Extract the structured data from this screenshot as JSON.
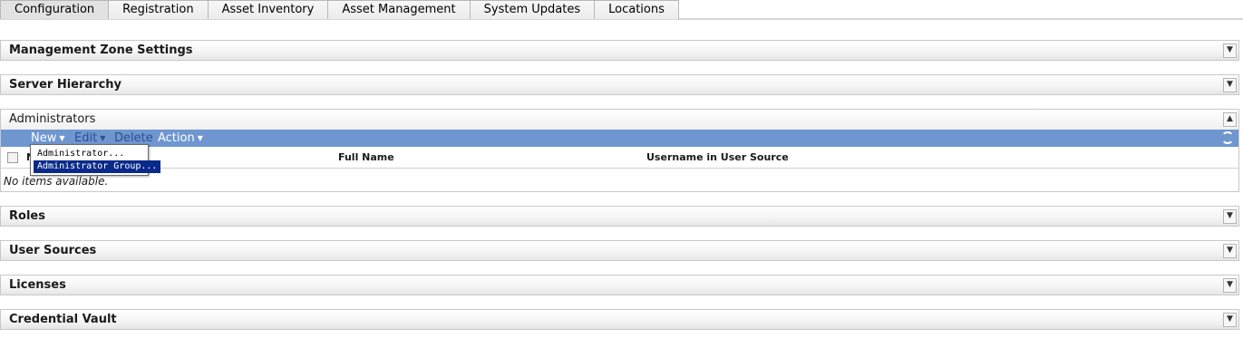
{
  "tabs": [
    {
      "label": "Configuration",
      "active": true
    },
    {
      "label": "Registration"
    },
    {
      "label": "Asset Inventory"
    },
    {
      "label": "Asset Management"
    },
    {
      "label": "System Updates"
    },
    {
      "label": "Locations"
    }
  ],
  "sections": {
    "management_zone": "Management Zone Settings",
    "server_hierarchy": "Server Hierarchy",
    "administrators": "Administrators",
    "roles": "Roles",
    "user_sources": "User Sources",
    "licenses": "Licenses",
    "credential_vault": "Credential Vault"
  },
  "toolbar": {
    "new_label": "New",
    "edit_label": "Edit",
    "delete_label": "Delete",
    "action_label": "Action"
  },
  "table": {
    "columns": [
      "N",
      "Full Name",
      "Username in User Source"
    ],
    "empty_text": "No items available."
  },
  "new_menu": {
    "items": [
      "Administrator...",
      "Administrator Group..."
    ]
  },
  "icons": {
    "expand": "chevron-double-down-icon",
    "collapse": "chevron-double-up-icon",
    "refresh": "refresh-icon",
    "caret": "caret-down-icon"
  },
  "colors": {
    "toolbar_bg": "#6f96cf",
    "menu_selected_bg": "#0a2a8a",
    "dim_text": "#2d4f90"
  }
}
